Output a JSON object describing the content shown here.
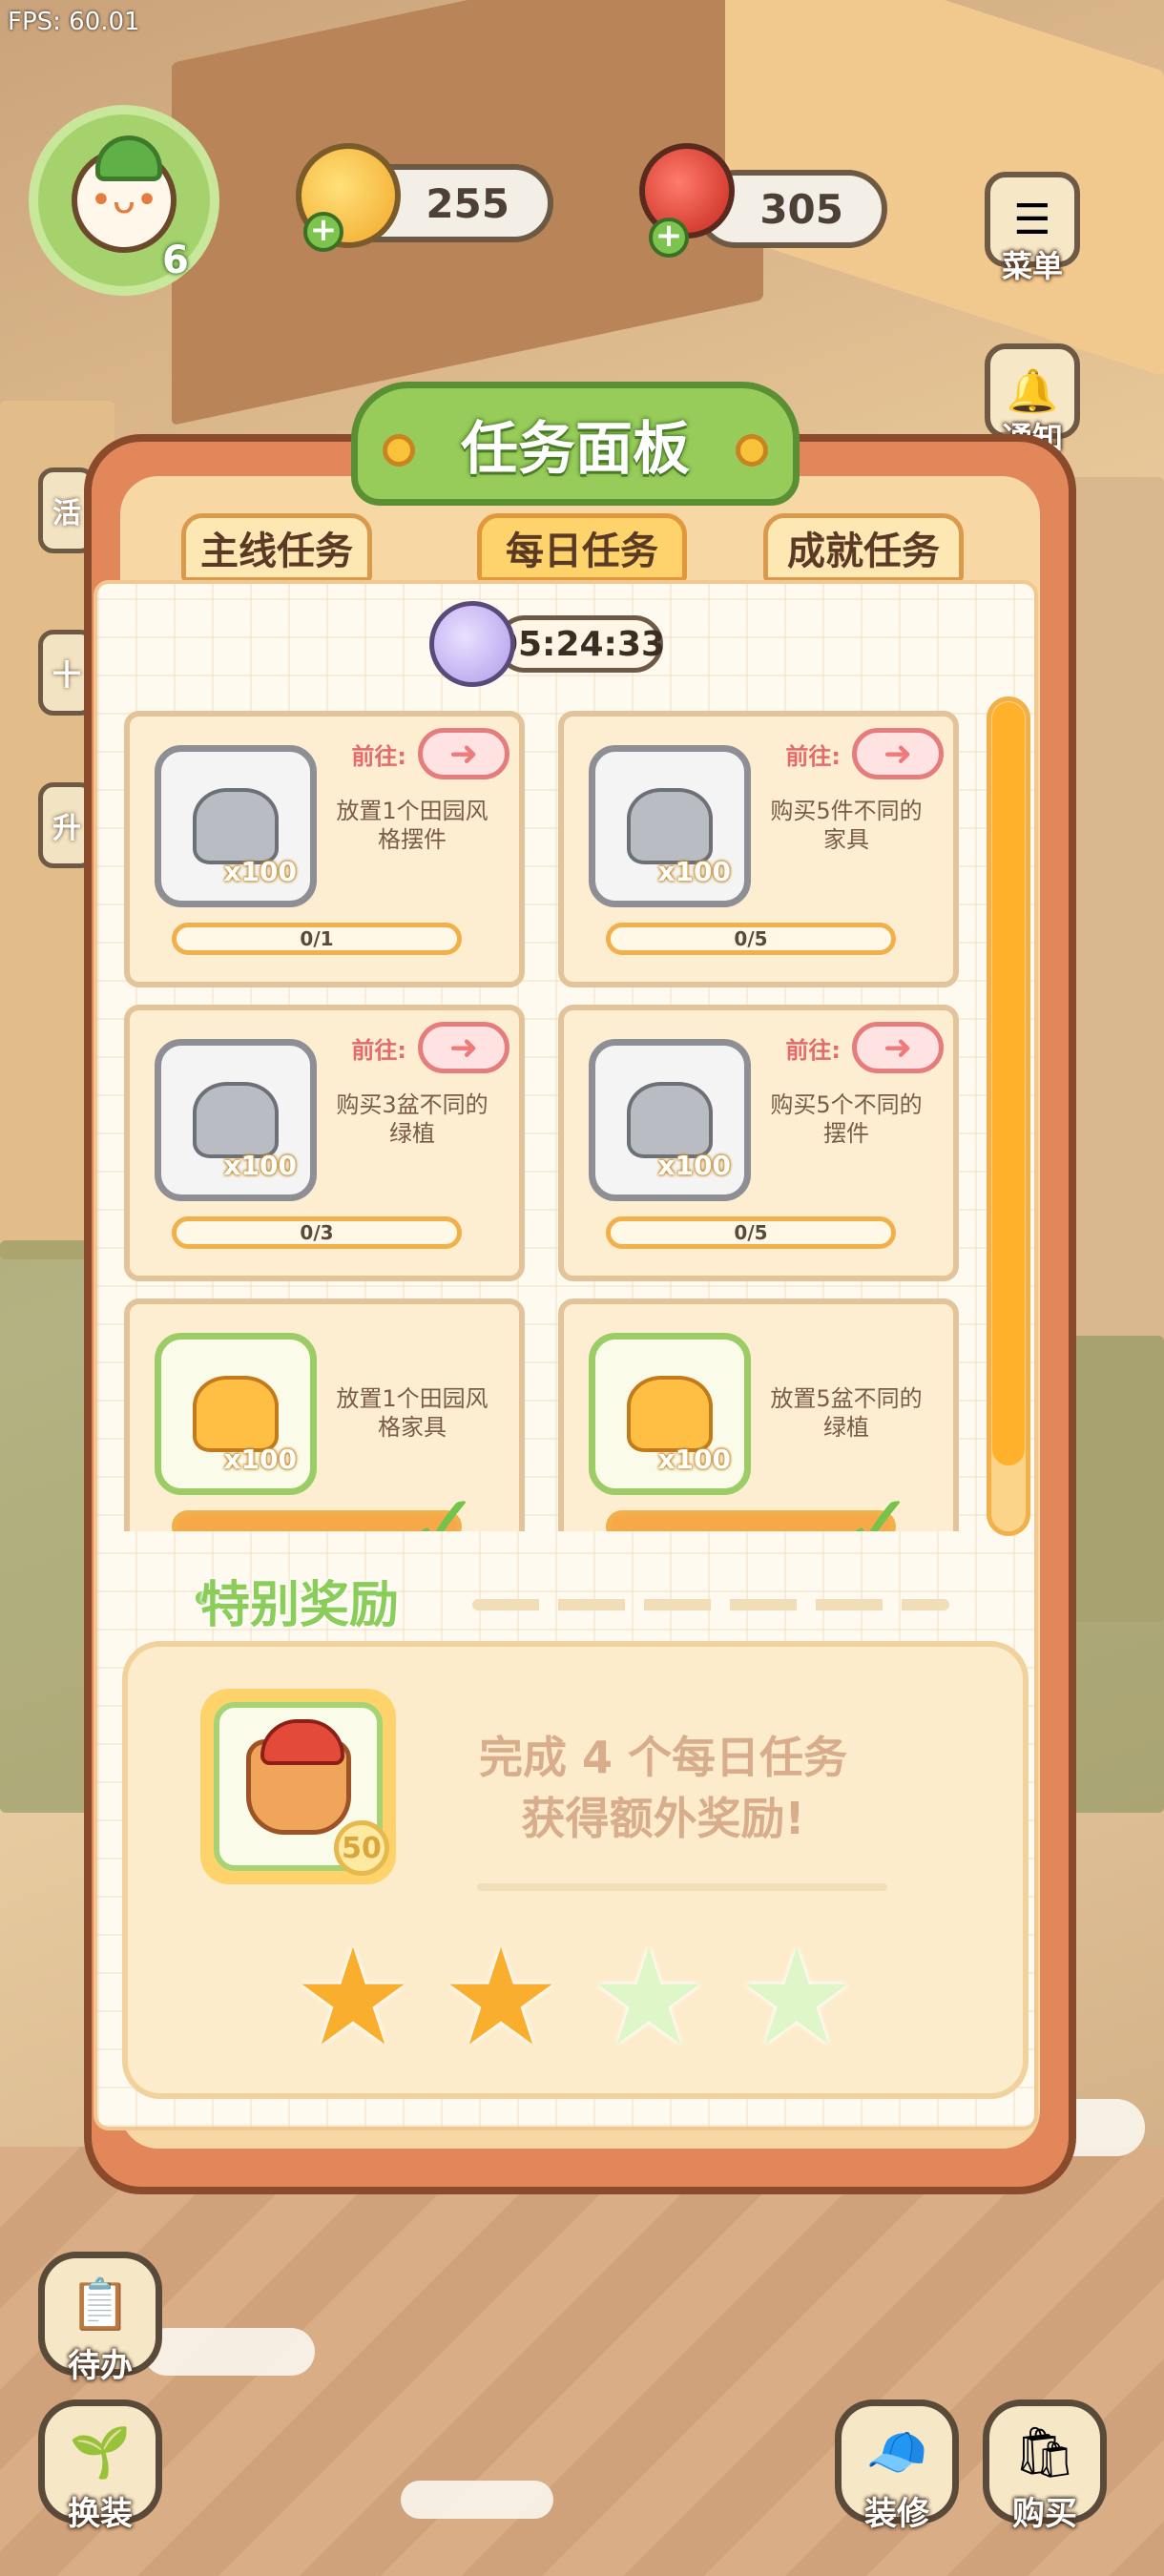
{
  "hud": {
    "fps": "FPS: 60.01",
    "player_level": "6",
    "coins": "255",
    "cherries": "305"
  },
  "side_menu": {
    "menu_label": "菜单",
    "notify_label": "通知",
    "left_stub_1": "活",
    "left_stub_2": "十",
    "left_stub_3": "升"
  },
  "panel": {
    "title": "任务面板",
    "tabs": [
      "主线任务",
      "每日任务",
      "成就任务"
    ],
    "active_tab": "每日任务",
    "timer": "05:24:33",
    "tasks": [
      {
        "goto": "前往:",
        "desc": "放置1个田园风格摆件",
        "qty": "x100",
        "progress": "0/1",
        "reward": "silver",
        "completed": false
      },
      {
        "goto": "前往:",
        "desc": "购买5件不同的家具",
        "qty": "x100",
        "progress": "0/5",
        "reward": "silver",
        "completed": false
      },
      {
        "goto": "前往:",
        "desc": "购买3盆不同的绿植",
        "qty": "x100",
        "progress": "0/3",
        "reward": "silver",
        "completed": false
      },
      {
        "goto": "前往:",
        "desc": "购买5个不同的摆件",
        "qty": "x100",
        "progress": "0/5",
        "reward": "silver",
        "completed": false
      },
      {
        "goto": "",
        "desc": "放置1个田园风格家具",
        "qty": "x100",
        "progress": "",
        "reward": "gold",
        "completed": true
      },
      {
        "goto": "",
        "desc": "放置5盆不同的绿植",
        "qty": "x100",
        "progress": "",
        "reward": "gold",
        "completed": true
      }
    ],
    "special": {
      "title": "特别奖励",
      "reward_qty": "50",
      "line1": "完成 4 个每日任务",
      "line2": "获得额外奖励!",
      "stars_earned": 2,
      "stars_total": 4
    }
  },
  "bottom_buttons": {
    "todo": "待办",
    "outfit": "换装",
    "decorate": "装修",
    "shop": "购买"
  },
  "colors": {
    "accent_green": "#97cc5a",
    "accent_orange": "#ffb12c",
    "panel_frame": "#e2875a"
  }
}
